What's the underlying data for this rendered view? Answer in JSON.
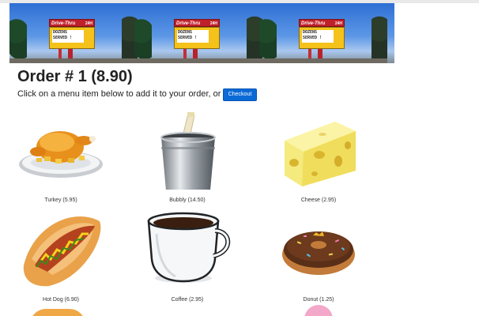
{
  "order": {
    "heading": "Order # 1 (8.90)",
    "intro": "Click on a menu item below to add it to your order, or",
    "checkout_label": "Checkout"
  },
  "banner": {
    "sign_brand": "Drive-Thru",
    "sign_hours": "24H",
    "sign_message": "DOZENS\nSERVED !"
  },
  "menu": {
    "items": [
      {
        "label": "Turkey (5.95)",
        "icon": "turkey-icon"
      },
      {
        "label": "Bubbly (14.50)",
        "icon": "bubbly-icon"
      },
      {
        "label": "Cheese (2.95)",
        "icon": "cheese-icon"
      },
      {
        "label": "Hot Dog (6.90)",
        "icon": "hotdog-icon"
      },
      {
        "label": "Coffee (2.95)",
        "icon": "coffee-icon"
      },
      {
        "label": "Donut (1.25)",
        "icon": "donut-icon"
      }
    ]
  }
}
